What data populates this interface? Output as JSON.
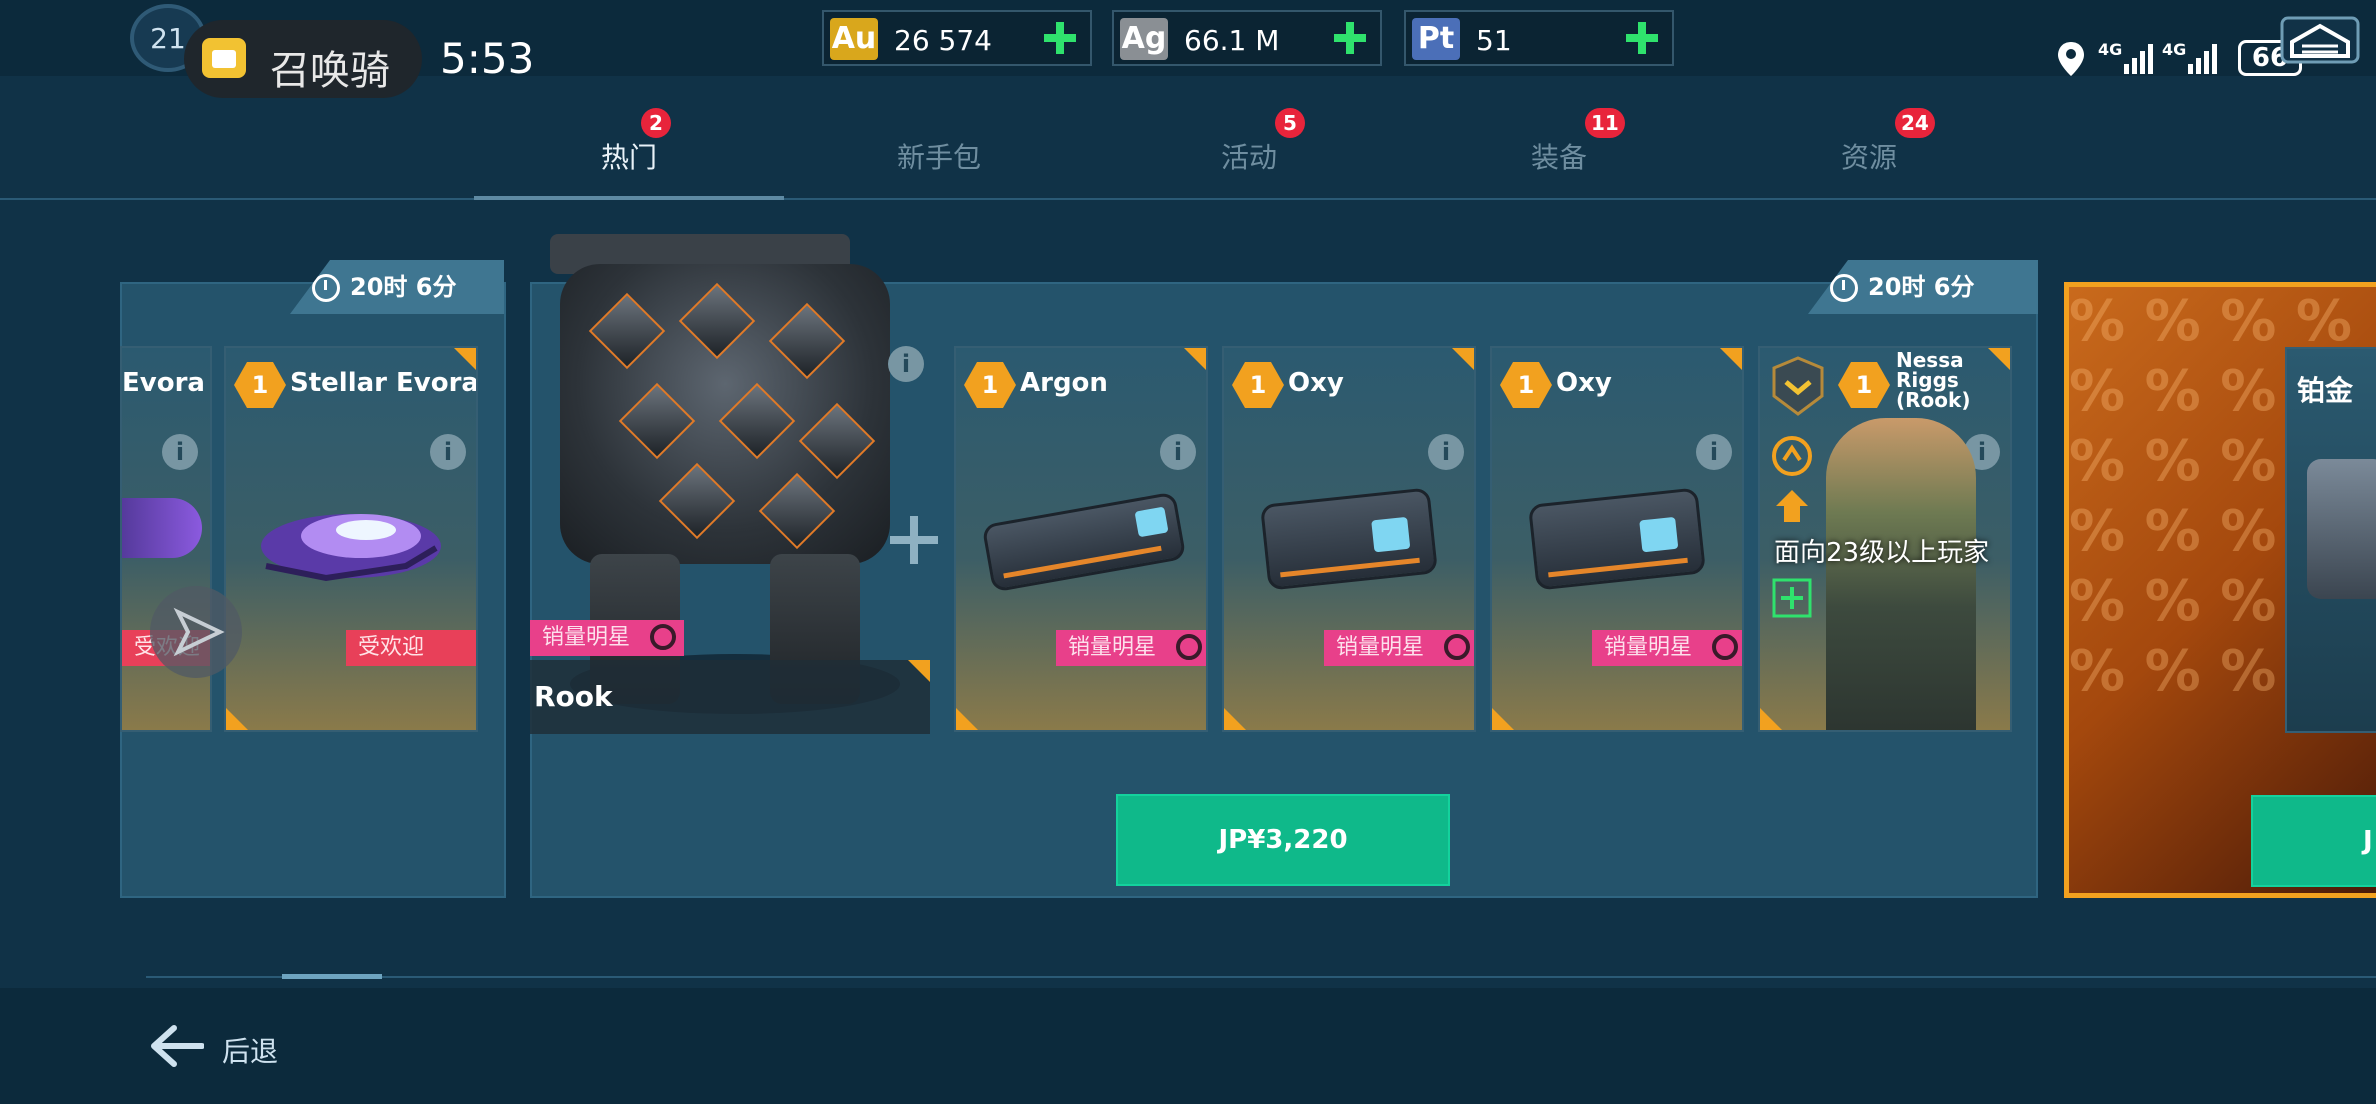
{
  "status": {
    "clock": "5:53",
    "level": "21",
    "summon_label": "召唤骑",
    "battery": "66",
    "network_1": "4G",
    "network_2": "4G"
  },
  "currencies": [
    {
      "symbol": "Au",
      "value": "26 574",
      "color": "#d9a71c"
    },
    {
      "symbol": "Ag",
      "value": "66.1 M",
      "color": "#8a8f94"
    },
    {
      "symbol": "Pt",
      "value": "51",
      "color": "#4b6fb8"
    }
  ],
  "tabs": [
    {
      "label": "热门",
      "badge": "2",
      "active": true
    },
    {
      "label": "新手包",
      "badge": "",
      "active": false
    },
    {
      "label": "活动",
      "badge": "5",
      "active": false
    },
    {
      "label": "装备",
      "badge": "11",
      "active": false
    },
    {
      "label": "资源",
      "badge": "24",
      "active": false
    }
  ],
  "left_panel": {
    "timer": "20时 6分",
    "cards": [
      {
        "name": "Evora",
        "tag": "受欢迎"
      },
      {
        "level": "1",
        "name": "Stellar Evora",
        "tag": "受欢迎"
      }
    ]
  },
  "main_panel": {
    "timer": "20时 6分",
    "robot_name": "Rook",
    "robot_tag": "销量明星",
    "cards": [
      {
        "level": "1",
        "name": "Argon",
        "tag": "销量明星"
      },
      {
        "level": "1",
        "name": "Oxy",
        "tag": "销量明星"
      },
      {
        "level": "1",
        "name": "Oxy",
        "tag": "销量明星"
      }
    ],
    "pilot": {
      "level": "1",
      "name": "Nessa Riggs (Rook)",
      "requirement": "面向23级以上玩家"
    },
    "price": "JP¥3,220"
  },
  "right_panel": {
    "title": "铂金",
    "price_partial": "J"
  },
  "footer": {
    "back_label": "后退"
  }
}
